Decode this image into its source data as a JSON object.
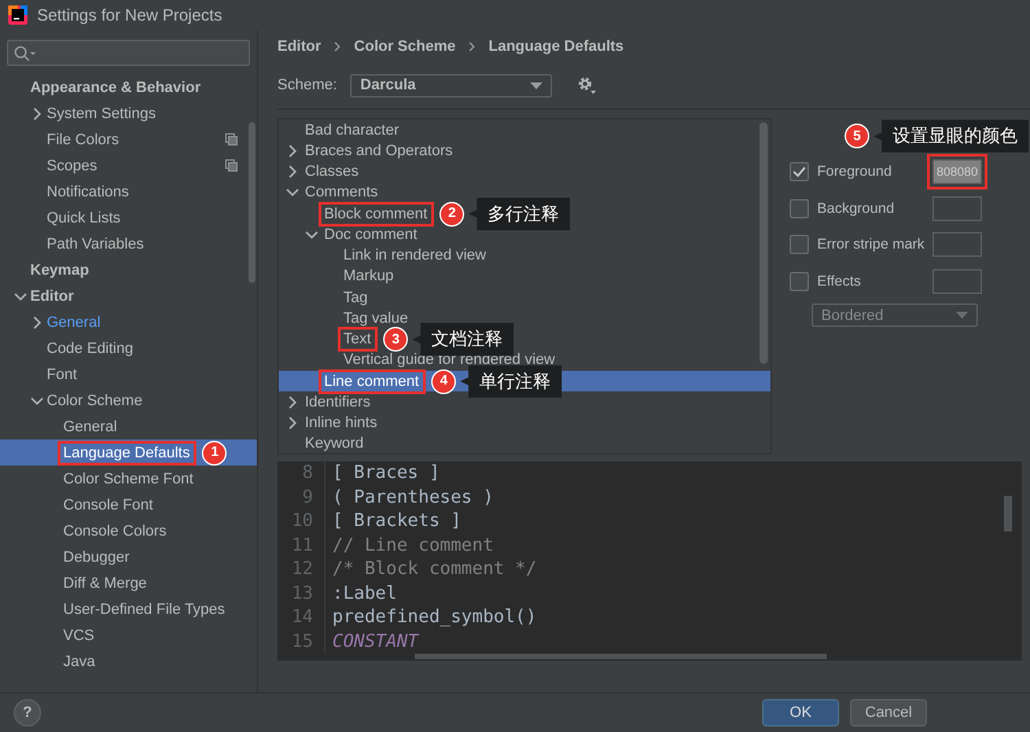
{
  "window": {
    "title": "Settings for New Projects"
  },
  "sidebar": {
    "items": [
      {
        "label": "Appearance & Behavior",
        "kind": "group",
        "selected": false,
        "children": [
          {
            "label": "System Settings",
            "selected": false,
            "expanded": false
          },
          {
            "label": "File Colors",
            "selected": false,
            "per_project": true
          },
          {
            "label": "Scopes",
            "selected": false,
            "per_project": true
          },
          {
            "label": "Notifications",
            "selected": false
          },
          {
            "label": "Quick Lists",
            "selected": false
          },
          {
            "label": "Path Variables",
            "selected": false
          }
        ]
      },
      {
        "label": "Keymap",
        "kind": "group",
        "selected": false
      },
      {
        "label": "Editor",
        "kind": "group",
        "selected": false,
        "expanded": true,
        "children": [
          {
            "label": "General",
            "selected": false,
            "expanded": false,
            "modified": true
          },
          {
            "label": "Code Editing",
            "selected": false
          },
          {
            "label": "Font",
            "selected": false
          },
          {
            "label": "Color Scheme",
            "selected": false,
            "expanded": true,
            "children": [
              {
                "label": "General",
                "selected": false
              },
              {
                "label": "Language Defaults",
                "selected": true,
                "callout": {
                  "number": "1"
                }
              },
              {
                "label": "Color Scheme Font",
                "selected": false
              },
              {
                "label": "Console Font",
                "selected": false
              },
              {
                "label": "Console Colors",
                "selected": false
              },
              {
                "label": "Debugger",
                "selected": false
              },
              {
                "label": "Diff & Merge",
                "selected": false
              },
              {
                "label": "User-Defined File Types",
                "selected": false
              },
              {
                "label": "VCS",
                "selected": false
              },
              {
                "label": "Java",
                "selected": false
              }
            ]
          }
        ]
      }
    ]
  },
  "breadcrumb": [
    "Editor",
    "Color Scheme",
    "Language Defaults"
  ],
  "scheme": {
    "label": "Scheme:",
    "value": "Darcula"
  },
  "attributes_tree": {
    "items": [
      {
        "label": "Bad character",
        "selected": false
      },
      {
        "label": "Braces and Operators",
        "selected": false,
        "expanded": false
      },
      {
        "label": "Classes",
        "selected": false,
        "expanded": false
      },
      {
        "label": "Comments",
        "selected": false,
        "expanded": true,
        "children": [
          {
            "label": "Block comment",
            "selected": false,
            "callout": {
              "number": "2",
              "note": "多行注释"
            }
          },
          {
            "label": "Doc comment",
            "selected": false,
            "expanded": true,
            "children": [
              {
                "label": "Link in rendered view",
                "selected": false
              },
              {
                "label": "Markup",
                "selected": false
              },
              {
                "label": "Tag",
                "selected": false
              },
              {
                "label": "Tag value",
                "selected": false
              },
              {
                "label": "Text",
                "selected": false,
                "callout": {
                  "number": "3",
                  "note": "文档注释"
                }
              },
              {
                "label": "Vertical guide for rendered view",
                "selected": false
              }
            ]
          },
          {
            "label": "Line comment",
            "selected": true,
            "callout": {
              "number": "4",
              "note": "单行注释"
            }
          }
        ]
      },
      {
        "label": "Identifiers",
        "selected": false,
        "expanded": false
      },
      {
        "label": "Inline hints",
        "selected": false,
        "expanded": false
      },
      {
        "label": "Keyword",
        "selected": false
      }
    ]
  },
  "attributes": {
    "options": [
      {
        "label": "Foreground",
        "checked": true,
        "swatch": "808080",
        "callout": {
          "number": "5",
          "note": "设置显眼的颜色"
        }
      },
      {
        "label": "Background",
        "checked": false
      },
      {
        "label": "Error stripe mark",
        "checked": false
      },
      {
        "label": "Effects",
        "checked": false
      }
    ],
    "effect_type": {
      "value": "Bordered",
      "disabled": true
    }
  },
  "preview": {
    "lines": [
      {
        "number": "8",
        "text": "[ Braces ]",
        "kind": "plain"
      },
      {
        "number": "9",
        "text": "( Parentheses )",
        "kind": "plain"
      },
      {
        "number": "10",
        "text": "[ Brackets ]",
        "kind": "plain"
      },
      {
        "number": "11",
        "text": "// Line comment",
        "kind": "comment"
      },
      {
        "number": "12",
        "text": "/* Block comment */",
        "kind": "comment"
      },
      {
        "number": "13",
        "text": ":Label",
        "kind": "plain"
      },
      {
        "number": "14",
        "text": "predefined_symbol()",
        "kind": "plain"
      },
      {
        "number": "15",
        "text": "CONSTANT",
        "kind": "constant"
      }
    ]
  },
  "help": {
    "label": "?"
  },
  "buttons": [
    {
      "label": "OK",
      "default": true
    },
    {
      "label": "Cancel",
      "default": false
    }
  ]
}
